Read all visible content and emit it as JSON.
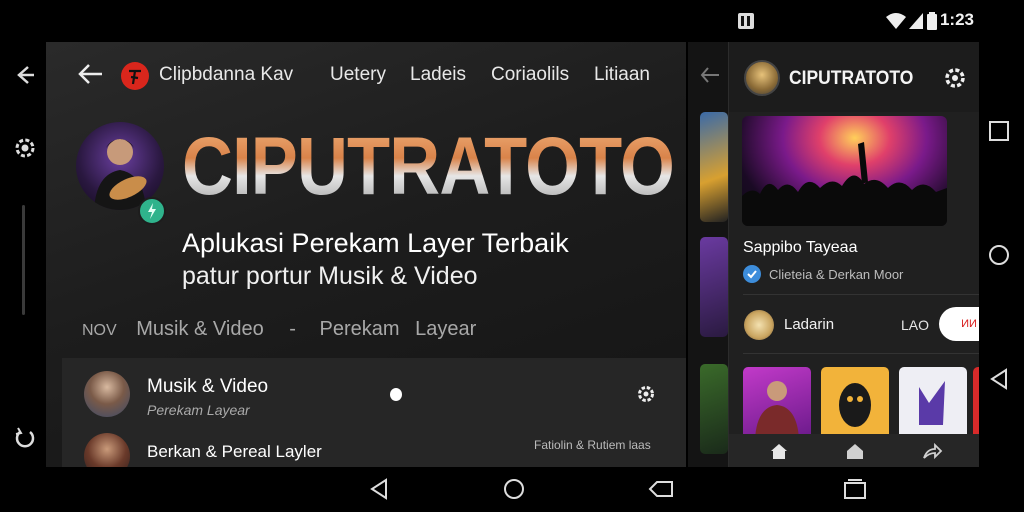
{
  "status_bar": {
    "time": "1:23",
    "icons": [
      "notification-icon",
      "wifi-icon",
      "signal-icon",
      "battery-icon"
    ]
  },
  "left_rail": {
    "icons": [
      "back-arrow-icon",
      "settings-icon",
      "rotate-icon"
    ]
  },
  "main": {
    "nav": {
      "back_icon": "back-arrow-icon",
      "logo_icon": "red-logo-icon",
      "tabs": [
        "Clipbdanna Kav",
        "Uetery",
        "Ladeis",
        "Coriaolils",
        "Litiaan"
      ]
    },
    "hero": {
      "title": "CIPUTRATOTO",
      "subtitle_line1": "Aplukasi Perekam Layer Terbaik",
      "subtitle_line2": "patur portur Musik & Video"
    },
    "breadcrumb": [
      "NOV",
      "Musik & Video",
      "-",
      "Perekam",
      "Layear"
    ],
    "list": [
      {
        "title": "Musik & Video",
        "subtitle": "Perekam Layear"
      },
      {
        "title": "Berkan  &  Pereal Layler",
        "meta": "Fatiolin & Rutiem laas"
      }
    ]
  },
  "right_panel": {
    "title": "CIPUTRATOTO",
    "card_title": "Sappibo Tayeaa",
    "card_subtitle": "Clieteia & Derkan Moor",
    "user_name": "Ladarin",
    "user_count": "LAO",
    "follow_label": "ИИ"
  },
  "colors": {
    "accent_red": "#d9261c",
    "badge_green": "#2fb38c",
    "check_blue": "#3d8ddb"
  }
}
